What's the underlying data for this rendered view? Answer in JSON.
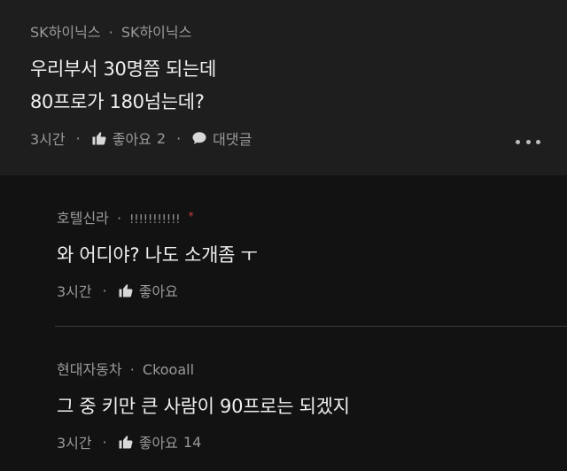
{
  "main": {
    "author": "SK하이닉스",
    "separator": "·",
    "company": "SK하이닉스",
    "lines": [
      "우리부서 30명쯤 되는데",
      "80프로가 180넘는데?"
    ],
    "time": "3시간",
    "like_label": "좋아요",
    "like_count": "2",
    "reply_label": "대댓글"
  },
  "replies": [
    {
      "author": "호텔신라",
      "separator": "·",
      "company": "!!!!!!!!!!!",
      "star": "*",
      "text": "와 어디야? 나도 소개좀 ㅜ",
      "time": "3시간",
      "like_label": "좋아요",
      "like_count": ""
    },
    {
      "author": "현대자동차",
      "separator": "·",
      "company": "Ckooall",
      "text": "그 중 키만 큰 사람이 90프로는 되겠지",
      "time": "3시간",
      "like_label": "좋아요",
      "like_count": "14"
    }
  ],
  "icons": {
    "like": "thumbs-up-icon",
    "reply": "speech-bubble-icon",
    "more": "more-dots-icon"
  }
}
